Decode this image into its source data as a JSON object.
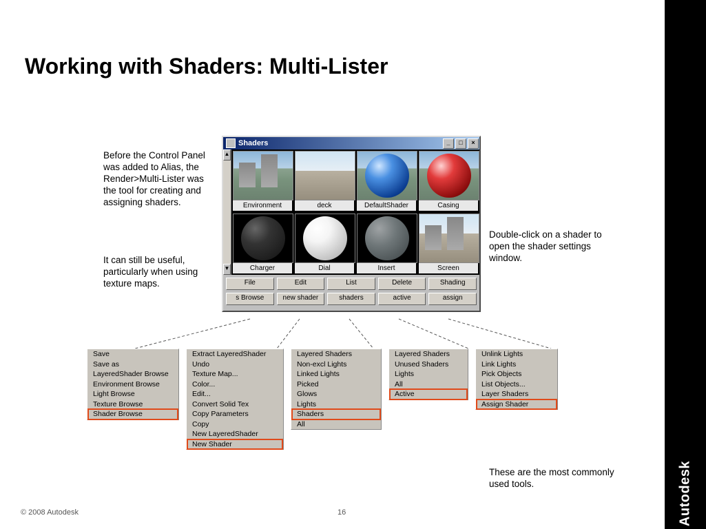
{
  "title": "Working with Shaders: Multi-Lister",
  "para_left1": "Before the Control Panel was added to Alias, the Render>Multi-Lister was the tool for creating and assigning shaders.",
  "para_left2": "It can still be useful, particularly when using texture maps.",
  "para_right": "Double-click on a shader to open the shader settings window.",
  "para_tools": "These are the  most commonly used tools.",
  "copyright": "© 2008 Autodesk",
  "pagenum": "16",
  "brand": "Autodesk",
  "window": {
    "title": "Shaders",
    "swatches_row1": [
      "Environment",
      "deck",
      "DefaultShader",
      "Casing"
    ],
    "swatches_row2": [
      "Charger",
      "Dial",
      "Insert",
      "Screen"
    ],
    "btn_row1": [
      "File",
      "Edit",
      "List",
      "Delete",
      "Shading"
    ],
    "btn_row2": [
      "s Browse",
      "new shader",
      "shaders",
      "active",
      "assign"
    ]
  },
  "menus": [
    {
      "items": [
        "Save",
        "Save as",
        "LayeredShader Browse",
        "Environment Browse",
        "Light Browse",
        "Texture Browse"
      ],
      "highlight": [
        "Shader Browse"
      ],
      "tail": []
    },
    {
      "items": [
        "Extract LayeredShader",
        "Undo",
        "Texture Map...",
        "Color...",
        "Edit...",
        "Convert Solid Tex",
        "Copy Parameters",
        "Copy",
        "New LayeredShader"
      ],
      "highlight": [
        "New Shader"
      ],
      "tail": []
    },
    {
      "items": [
        "Layered Shaders",
        "Non-excl Lights",
        "Linked Lights",
        "Picked",
        "Glows",
        "Lights"
      ],
      "highlight": [
        "Shaders"
      ],
      "tail": [
        "All"
      ]
    },
    {
      "items": [
        "Layered Shaders",
        "Unused Shaders",
        "Lights",
        "All"
      ],
      "highlight": [
        "Active"
      ],
      "tail": []
    },
    {
      "items": [
        "Unlink Lights",
        "Link Lights",
        "Pick Objects",
        "List Objects...",
        "Layer Shaders"
      ],
      "highlight": [
        "Assign Shader"
      ],
      "tail": []
    }
  ]
}
